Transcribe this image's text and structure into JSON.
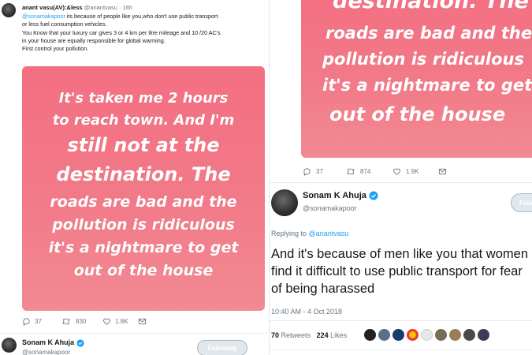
{
  "left": {
    "reply": {
      "display_name": "anant vasu(AV):&less",
      "handle": "@anantvasu",
      "separator": "·",
      "time": "16h",
      "mention": "@sonamakapoor",
      "text_lines": [
        "its because of people like you,who don't use public transport",
        "or less fuel consumption vehicles.",
        "You Know that your luxury car gives 3 or 4 km per litre mileage and  10 /20 AC's",
        "in your house are equally responsible for global warming.",
        "First control your pollution."
      ]
    },
    "quote_lines": [
      "It's taken me 2 hours",
      "to reach town. And I'm",
      "still not at the",
      "destination. The",
      "roads are bad and the",
      "pollution is ridiculous",
      "it's a nightmare to get",
      "out of the house"
    ],
    "actions": {
      "replies": "37",
      "retweets": "830",
      "likes": "1.8K"
    },
    "next_tweet": {
      "display_name": "Sonam K Ahuja",
      "handle": "@sonamakapoor",
      "follow_label": "Following"
    }
  },
  "right": {
    "quote_lines": [
      "destination. The",
      "roads are bad and the",
      "pollution is ridiculous",
      "it's a nightmare to get",
      "out of the house"
    ],
    "actions": {
      "replies": "37",
      "retweets": "874",
      "likes": "1.9K"
    },
    "tweet": {
      "display_name": "Sonam K Ahuja",
      "handle": "@sonamakapoor",
      "follow_label": "Following",
      "replying_prefix": "Replying to",
      "replying_handle": "@anantvasu",
      "text_lines": [
        "And it's because of men like you that women",
        "find it difficult to use public transport for fear",
        "of being harassed"
      ],
      "timestamp": "10:40 AM - 4 Oct 2018",
      "retweets_count": "70",
      "retweets_label": "Retweets",
      "likes_count": "224",
      "likes_label": "Likes"
    }
  },
  "colors": {
    "quote_gradient_top": "#f36f82",
    "quote_gradient_bottom": "#f18a93",
    "twitter_blue": "#1da1f2",
    "secondary_text": "#657786"
  },
  "icons": [
    "reply-icon",
    "retweet-icon",
    "like-icon",
    "dm-icon",
    "verified-badge-icon"
  ]
}
